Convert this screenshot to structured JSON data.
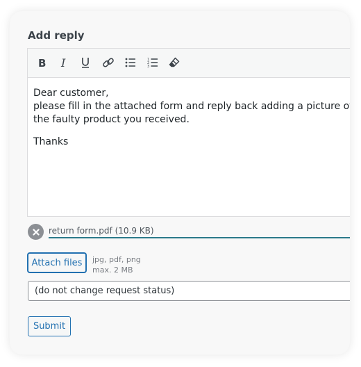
{
  "form": {
    "title": "Add reply"
  },
  "toolbar": {
    "buttons": [
      {
        "icon": "bold-icon",
        "label": "Bold"
      },
      {
        "icon": "italic-icon",
        "label": "Italic"
      },
      {
        "icon": "underline-icon",
        "label": "Underline"
      },
      {
        "icon": "link-icon",
        "label": "Insert link"
      },
      {
        "icon": "bulleted-list-icon",
        "label": "Bulleted list"
      },
      {
        "icon": "numbered-list-icon",
        "label": "Numbered list"
      },
      {
        "icon": "eraser-icon",
        "label": "Clear formatting"
      }
    ]
  },
  "editor": {
    "line1": "Dear customer,",
    "line2": "please fill in the attached form and reply back adding a picture of",
    "line3": "the faulty product you received.",
    "line4": "Thanks"
  },
  "attachment": {
    "file_name": "return form.pdf (10.9 KB)",
    "remove_icon": "close-icon"
  },
  "attach": {
    "button_label": "Attach files",
    "allowed_types": "jpg, pdf, png",
    "max_size": "max. 2 MB"
  },
  "status": {
    "selected": "(do not change request status)"
  },
  "submit": {
    "label": "Submit"
  },
  "colors": {
    "accent": "#2271b1",
    "file_underline": "#2c7a8a",
    "remove_button": "#8c8f94"
  }
}
